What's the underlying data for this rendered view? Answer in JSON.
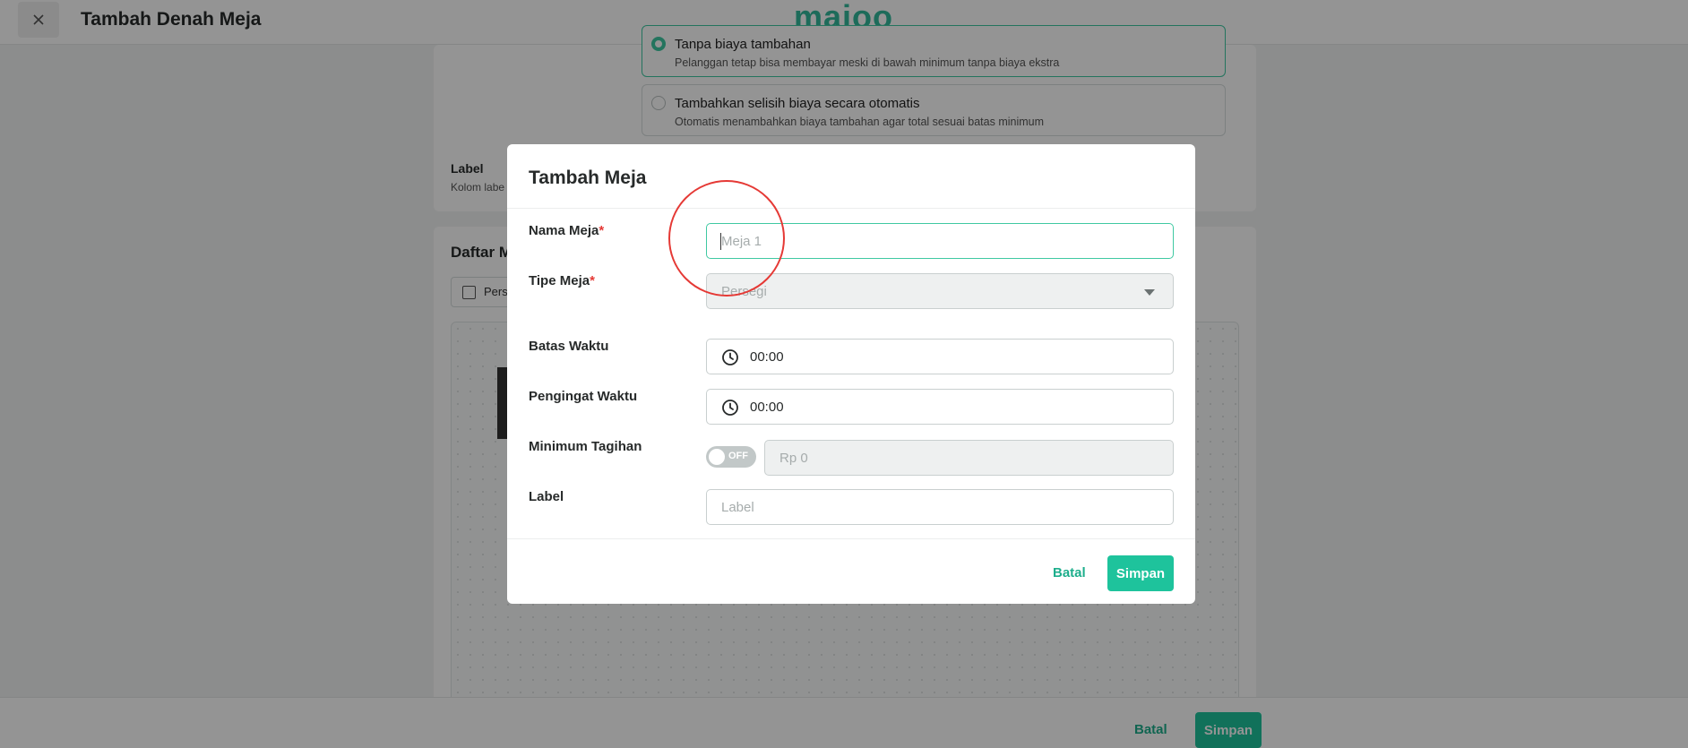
{
  "header": {
    "close_icon": "close-icon",
    "title": "Tambah Denah Meja",
    "logo_text": "majoo",
    "logo_color": "#32b89b"
  },
  "background_form": {
    "options": [
      {
        "title": "Tanpa biaya tambahan",
        "desc": "Pelanggan tetap bisa membayar meski di bawah minimum tanpa biaya ekstra",
        "selected": true
      },
      {
        "title": "Tambahkan selisih biaya secara otomatis",
        "desc": "Otomatis menambahkan biaya tambahan agar total sesuai batas minimum",
        "selected": false
      }
    ],
    "label_title": "Label",
    "label_desc": "Kolom labe",
    "list_title": "Daftar M",
    "checkbox_label": "Pers"
  },
  "footer": {
    "cancel_label": "Batal",
    "save_label": "Simpan"
  },
  "modal": {
    "title": "Tambah Meja",
    "fields": {
      "nama_meja": {
        "label": "Nama Meja",
        "required": "*",
        "placeholder": "Meja 1",
        "value": ""
      },
      "tipe_meja": {
        "label": "Tipe Meja",
        "required": "*",
        "selected": "Persegi"
      },
      "batas_waktu": {
        "label": "Batas Waktu",
        "value": "00:00"
      },
      "pengingat_waktu": {
        "label": "Pengingat Waktu",
        "value": "00:00"
      },
      "minimum_tagihan": {
        "label": "Minimum Tagihan",
        "toggle_state": "OFF",
        "placeholder": "Rp 0"
      },
      "label": {
        "label": "Label",
        "placeholder": "Label"
      }
    },
    "cancel_label": "Batal",
    "save_label": "Simpan"
  },
  "colors": {
    "accent": "#1ec39c",
    "required": "#e53935",
    "annotation_circle": "#e53935"
  }
}
